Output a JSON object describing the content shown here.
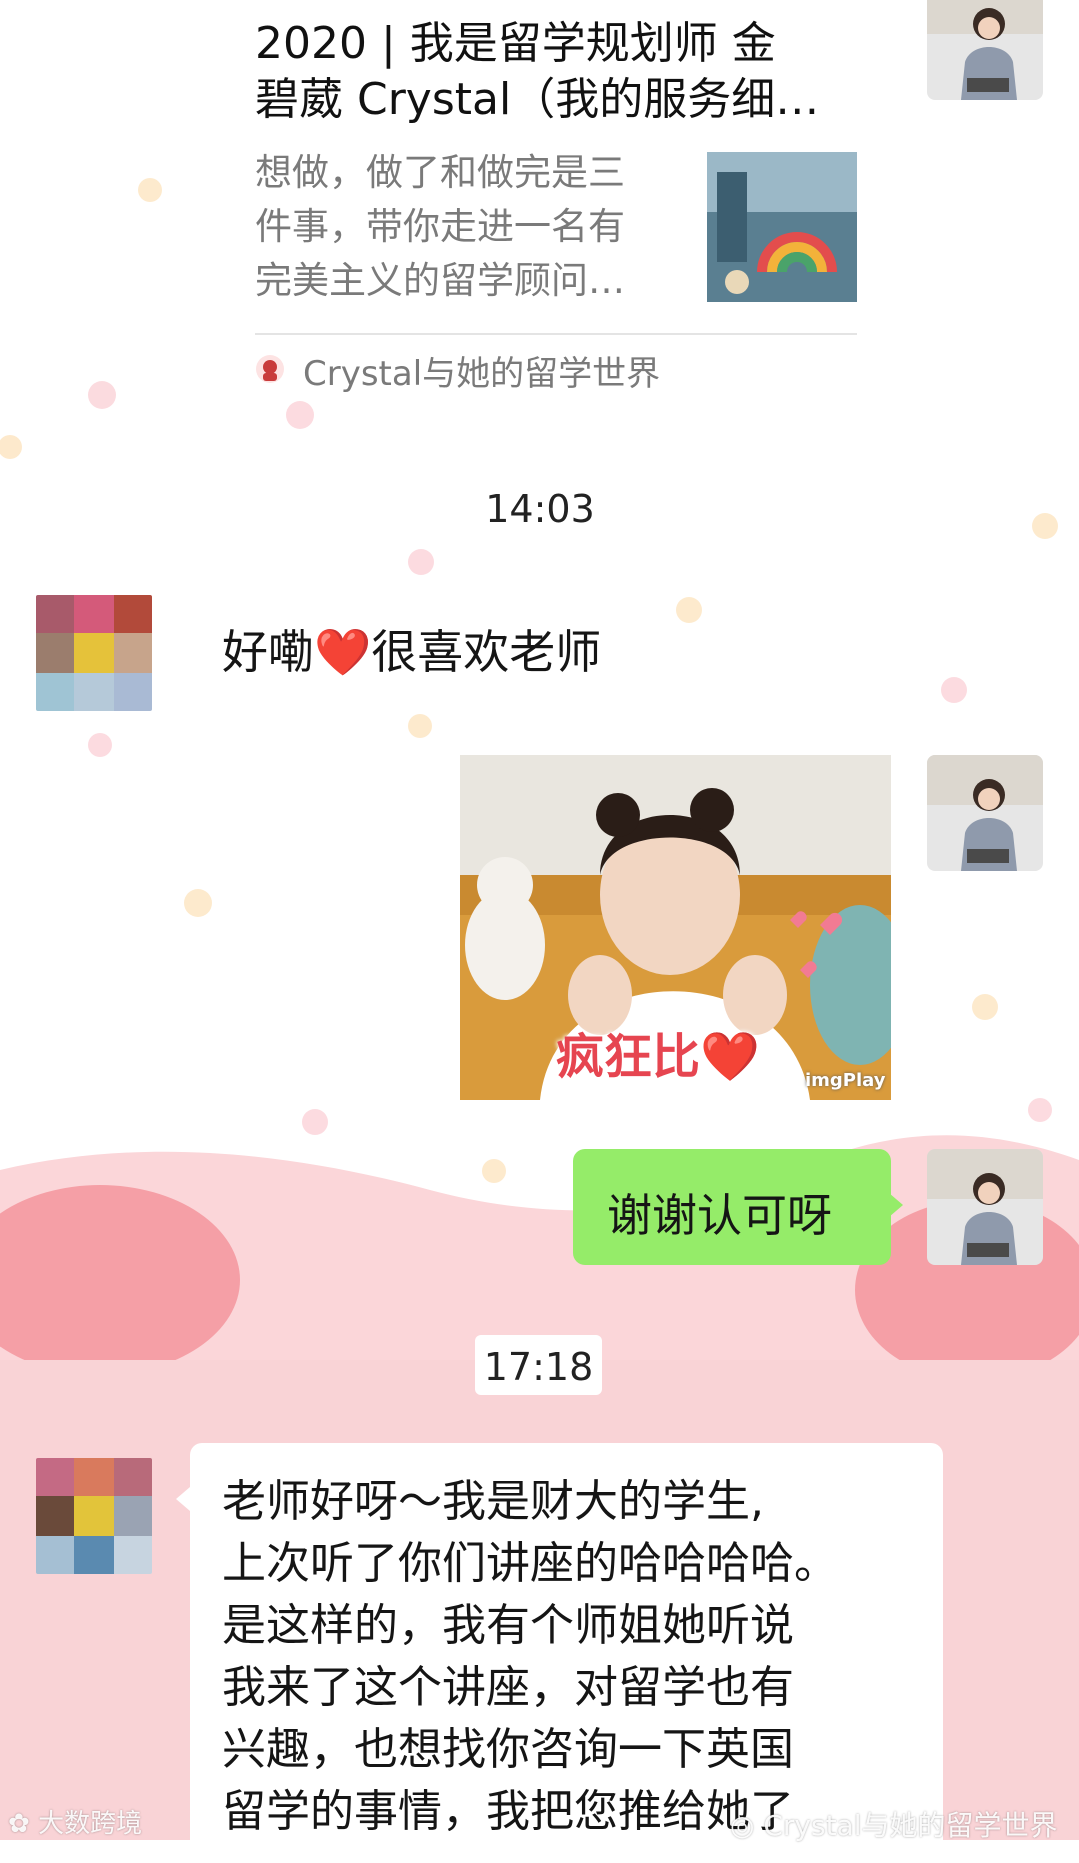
{
  "article": {
    "title": "2020 | 我是留学规划师 金碧葳 Crystal（我的服务细...",
    "title_line1": "2020 | 我是留学规划师 金",
    "title_line2": "碧葳 Crystal（我的服务细…",
    "desc_line1": "想做，做了和做完是三",
    "desc_line2": "件事，带你走进一名有",
    "desc_line3": "完美主义的留学顾问…",
    "source": "Crystal与她的留学世界"
  },
  "messages": [
    {
      "type": "timestamp",
      "text": "14:03"
    },
    {
      "type": "received",
      "text": "好嘞❤️很喜欢老师"
    },
    {
      "type": "sent_image",
      "caption": "疯狂比❤️",
      "brand": "imgPlay"
    },
    {
      "type": "sent",
      "text": "谢谢认可呀"
    },
    {
      "type": "timestamp",
      "text": "17:18"
    },
    {
      "type": "received",
      "lines": [
        "老师好呀～我是财大的学生,",
        "上次听了你们讲座的哈哈哈哈。",
        "是这样的，我有个师姐她听说",
        "我来了这个讲座，对留学也有",
        "兴趣，也想找你咨询一下英国",
        "留学的事情，我把您推给她了"
      ]
    }
  ],
  "watermarks": {
    "left": "大数跨境",
    "right": "Crystal与她的留学世界"
  },
  "colors": {
    "sent_bubble": "#95EC69",
    "received_bubble": "#FFFFFF",
    "bg_pink": "#F9D3D6",
    "bg_pink_dark": "#F59FA6"
  }
}
